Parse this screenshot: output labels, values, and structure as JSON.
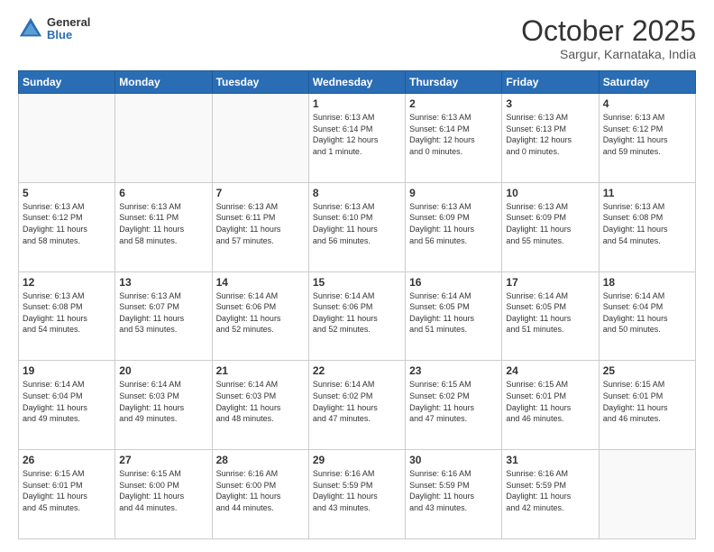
{
  "header": {
    "logo": {
      "general": "General",
      "blue": "Blue"
    },
    "title": "October 2025",
    "subtitle": "Sargur, Karnataka, India"
  },
  "calendar": {
    "weekdays": [
      "Sunday",
      "Monday",
      "Tuesday",
      "Wednesday",
      "Thursday",
      "Friday",
      "Saturday"
    ],
    "weeks": [
      [
        {
          "day": "",
          "info": ""
        },
        {
          "day": "",
          "info": ""
        },
        {
          "day": "",
          "info": ""
        },
        {
          "day": "1",
          "info": "Sunrise: 6:13 AM\nSunset: 6:14 PM\nDaylight: 12 hours\nand 1 minute."
        },
        {
          "day": "2",
          "info": "Sunrise: 6:13 AM\nSunset: 6:14 PM\nDaylight: 12 hours\nand 0 minutes."
        },
        {
          "day": "3",
          "info": "Sunrise: 6:13 AM\nSunset: 6:13 PM\nDaylight: 12 hours\nand 0 minutes."
        },
        {
          "day": "4",
          "info": "Sunrise: 6:13 AM\nSunset: 6:12 PM\nDaylight: 11 hours\nand 59 minutes."
        }
      ],
      [
        {
          "day": "5",
          "info": "Sunrise: 6:13 AM\nSunset: 6:12 PM\nDaylight: 11 hours\nand 58 minutes."
        },
        {
          "day": "6",
          "info": "Sunrise: 6:13 AM\nSunset: 6:11 PM\nDaylight: 11 hours\nand 58 minutes."
        },
        {
          "day": "7",
          "info": "Sunrise: 6:13 AM\nSunset: 6:11 PM\nDaylight: 11 hours\nand 57 minutes."
        },
        {
          "day": "8",
          "info": "Sunrise: 6:13 AM\nSunset: 6:10 PM\nDaylight: 11 hours\nand 56 minutes."
        },
        {
          "day": "9",
          "info": "Sunrise: 6:13 AM\nSunset: 6:09 PM\nDaylight: 11 hours\nand 56 minutes."
        },
        {
          "day": "10",
          "info": "Sunrise: 6:13 AM\nSunset: 6:09 PM\nDaylight: 11 hours\nand 55 minutes."
        },
        {
          "day": "11",
          "info": "Sunrise: 6:13 AM\nSunset: 6:08 PM\nDaylight: 11 hours\nand 54 minutes."
        }
      ],
      [
        {
          "day": "12",
          "info": "Sunrise: 6:13 AM\nSunset: 6:08 PM\nDaylight: 11 hours\nand 54 minutes."
        },
        {
          "day": "13",
          "info": "Sunrise: 6:13 AM\nSunset: 6:07 PM\nDaylight: 11 hours\nand 53 minutes."
        },
        {
          "day": "14",
          "info": "Sunrise: 6:14 AM\nSunset: 6:06 PM\nDaylight: 11 hours\nand 52 minutes."
        },
        {
          "day": "15",
          "info": "Sunrise: 6:14 AM\nSunset: 6:06 PM\nDaylight: 11 hours\nand 52 minutes."
        },
        {
          "day": "16",
          "info": "Sunrise: 6:14 AM\nSunset: 6:05 PM\nDaylight: 11 hours\nand 51 minutes."
        },
        {
          "day": "17",
          "info": "Sunrise: 6:14 AM\nSunset: 6:05 PM\nDaylight: 11 hours\nand 51 minutes."
        },
        {
          "day": "18",
          "info": "Sunrise: 6:14 AM\nSunset: 6:04 PM\nDaylight: 11 hours\nand 50 minutes."
        }
      ],
      [
        {
          "day": "19",
          "info": "Sunrise: 6:14 AM\nSunset: 6:04 PM\nDaylight: 11 hours\nand 49 minutes."
        },
        {
          "day": "20",
          "info": "Sunrise: 6:14 AM\nSunset: 6:03 PM\nDaylight: 11 hours\nand 49 minutes."
        },
        {
          "day": "21",
          "info": "Sunrise: 6:14 AM\nSunset: 6:03 PM\nDaylight: 11 hours\nand 48 minutes."
        },
        {
          "day": "22",
          "info": "Sunrise: 6:14 AM\nSunset: 6:02 PM\nDaylight: 11 hours\nand 47 minutes."
        },
        {
          "day": "23",
          "info": "Sunrise: 6:15 AM\nSunset: 6:02 PM\nDaylight: 11 hours\nand 47 minutes."
        },
        {
          "day": "24",
          "info": "Sunrise: 6:15 AM\nSunset: 6:01 PM\nDaylight: 11 hours\nand 46 minutes."
        },
        {
          "day": "25",
          "info": "Sunrise: 6:15 AM\nSunset: 6:01 PM\nDaylight: 11 hours\nand 46 minutes."
        }
      ],
      [
        {
          "day": "26",
          "info": "Sunrise: 6:15 AM\nSunset: 6:01 PM\nDaylight: 11 hours\nand 45 minutes."
        },
        {
          "day": "27",
          "info": "Sunrise: 6:15 AM\nSunset: 6:00 PM\nDaylight: 11 hours\nand 44 minutes."
        },
        {
          "day": "28",
          "info": "Sunrise: 6:16 AM\nSunset: 6:00 PM\nDaylight: 11 hours\nand 44 minutes."
        },
        {
          "day": "29",
          "info": "Sunrise: 6:16 AM\nSunset: 5:59 PM\nDaylight: 11 hours\nand 43 minutes."
        },
        {
          "day": "30",
          "info": "Sunrise: 6:16 AM\nSunset: 5:59 PM\nDaylight: 11 hours\nand 43 minutes."
        },
        {
          "day": "31",
          "info": "Sunrise: 6:16 AM\nSunset: 5:59 PM\nDaylight: 11 hours\nand 42 minutes."
        },
        {
          "day": "",
          "info": ""
        }
      ]
    ]
  }
}
